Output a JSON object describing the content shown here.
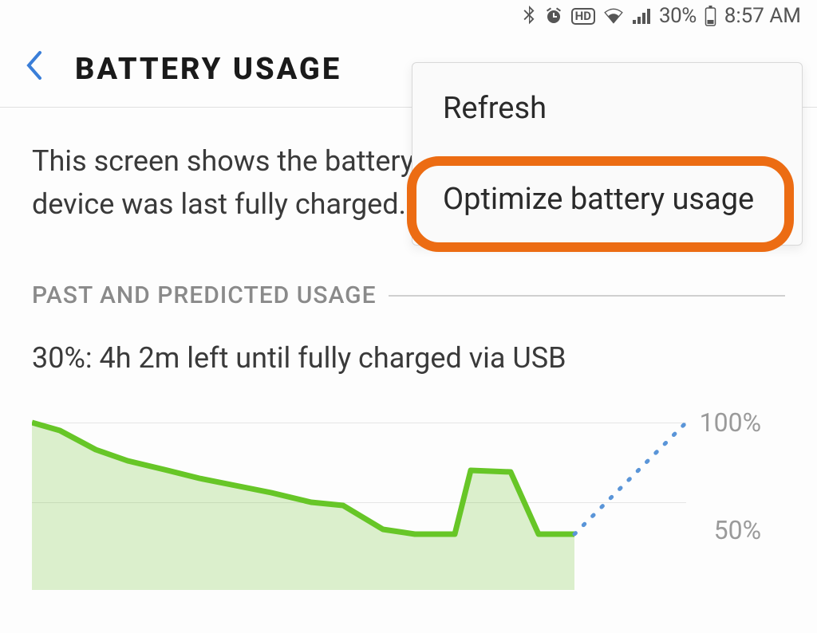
{
  "status_bar": {
    "battery_percent": "30%",
    "time": "8:57 AM",
    "hd_label": "HD"
  },
  "app_bar": {
    "title": "BATTERY USAGE"
  },
  "description": "This screen shows the battery usage data since the device was last fully charged.",
  "section_title": "PAST AND PREDICTED USAGE",
  "charge_status": "30%: 4h 2m left until fully charged via USB",
  "menu": {
    "items": [
      {
        "label": "Refresh"
      },
      {
        "label": "Optimize battery usage"
      }
    ]
  },
  "chart_data": {
    "type": "area",
    "ylabel": "",
    "ylim": [
      0,
      100
    ],
    "y_ticks": [
      "100%",
      "50%"
    ],
    "series": [
      {
        "name": "past",
        "style": "solid-area",
        "values": [
          100,
          95,
          83,
          76,
          70,
          65,
          60,
          56,
          50,
          48,
          33,
          30,
          30,
          70,
          69,
          30,
          30
        ]
      },
      {
        "name": "predicted-charge",
        "style": "dotted",
        "values": [
          30,
          100
        ]
      }
    ]
  }
}
